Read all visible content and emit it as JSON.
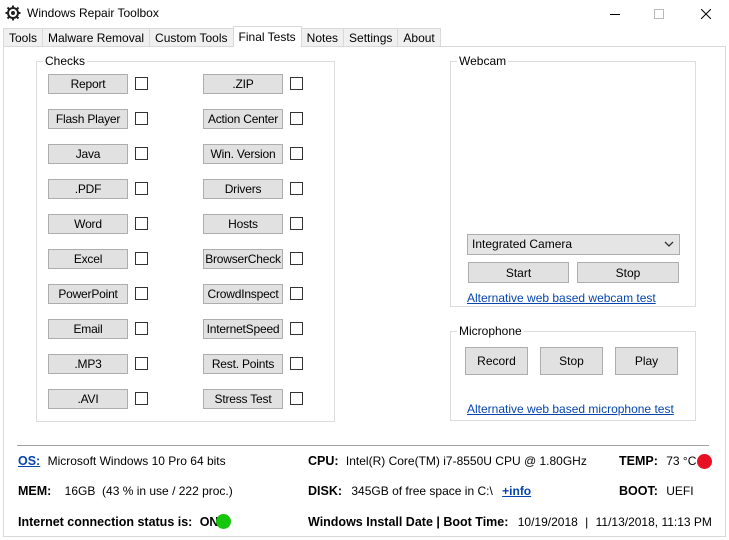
{
  "window": {
    "title": "Windows Repair Toolbox"
  },
  "tabs": [
    "Tools",
    "Malware Removal",
    "Custom Tools",
    "Final Tests",
    "Notes",
    "Settings",
    "About"
  ],
  "active_tab": "Final Tests",
  "checks": {
    "title": "Checks",
    "left": [
      "Report",
      "Flash Player",
      "Java",
      ".PDF",
      "Word",
      "Excel",
      "PowerPoint",
      "Email",
      ".MP3",
      ".AVI"
    ],
    "right": [
      ".ZIP",
      "Action Center",
      "Win. Version",
      "Drivers",
      "Hosts",
      "BrowserCheck",
      "CrowdInspect",
      "InternetSpeed",
      "Rest. Points",
      "Stress Test"
    ]
  },
  "webcam": {
    "title": "Webcam",
    "camera_selected": "Integrated Camera",
    "start_label": "Start",
    "stop_label": "Stop",
    "alt_link": "Alternative web based webcam test"
  },
  "microphone": {
    "title": "Microphone",
    "record_label": "Record",
    "stop_label": "Stop",
    "play_label": "Play",
    "alt_link": "Alternative web based microphone test"
  },
  "info": {
    "os_label": "OS:",
    "os_value": "Microsoft Windows 10 Pro 64 bits",
    "cpu_label": "CPU:",
    "cpu_value": "Intel(R) Core(TM) i7-8550U CPU @ 1.80GHz",
    "temp_label": "TEMP:",
    "temp_value": "73 °C",
    "temp_status_color": "#e81123",
    "mem_label": "MEM:",
    "mem_value": "16GB  (43 % in use / 222 proc.)",
    "disk_label": "DISK:",
    "disk_value": "345GB of free space in C:\\",
    "disk_more": "+info",
    "boot_label": "BOOT:",
    "boot_value": "UEFI",
    "internet_label": "Internet connection status is:",
    "internet_value": "ON",
    "internet_status_color": "#16c60c",
    "install_label": "Windows Install Date | Boot Time:",
    "install_date": "10/19/2018",
    "boot_time": "11/13/2018, 11:13 PM"
  }
}
